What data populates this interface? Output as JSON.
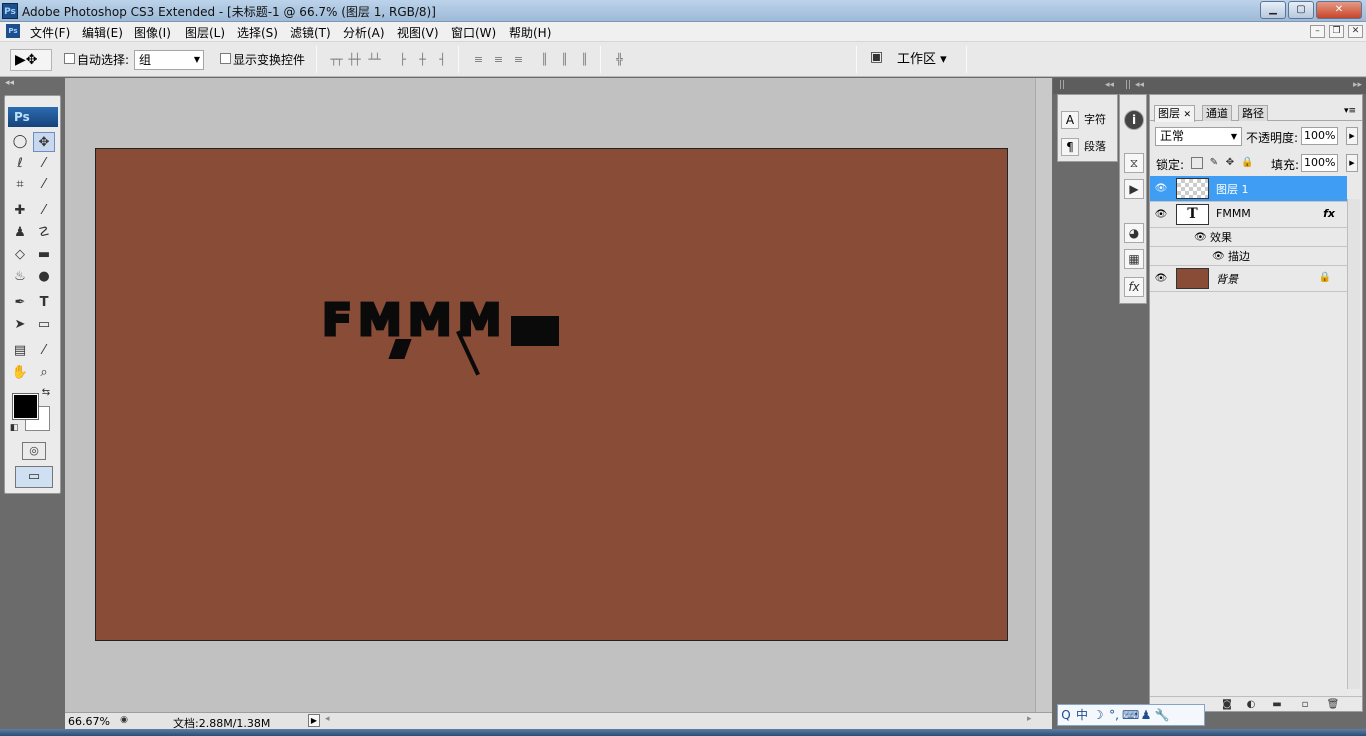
{
  "window": {
    "title": "Adobe Photoshop CS3 Extended - [未标题-1 @ 66.7% (图层 1, RGB/8)]",
    "ps_logo": "Ps",
    "min": "▁",
    "max": "▢",
    "close": "✕"
  },
  "menu": {
    "items": [
      "文件(F)",
      "编辑(E)",
      "图像(I)",
      "图层(L)",
      "选择(S)",
      "滤镜(T)",
      "分析(A)",
      "视图(V)",
      "窗口(W)",
      "帮助(H)"
    ],
    "mdi_min": "–",
    "mdi_restore": "❐",
    "mdi_close": "✕"
  },
  "options": {
    "tool_preset": "▶✥",
    "auto_select_label": "自动选择:",
    "auto_select_value": "组",
    "show_transform_label": "显示变换控件",
    "workspace_label": "工作区 ▾"
  },
  "toolbox": {
    "badge": "Ps"
  },
  "document": {
    "text": "FMMM"
  },
  "status": {
    "zoom": "66.67%",
    "doc_size": "文档:2.88M/1.38M"
  },
  "mini_panel": {
    "char_label": "字符",
    "para_label": "段落",
    "char_icon": "A",
    "para_icon": "¶"
  },
  "layers_panel": {
    "tabs": [
      "图层",
      "通道",
      "路径"
    ],
    "blend_mode": "正常",
    "opacity_label": "不透明度:",
    "opacity_value": "100%",
    "lock_label": "锁定:",
    "fill_label": "填充:",
    "fill_value": "100%",
    "layers": [
      {
        "name": "图层 1",
        "selected": true
      },
      {
        "name": "FMMM",
        "thumb_text": "T",
        "fx": "fx"
      },
      {
        "name": "背景",
        "locked": true
      }
    ],
    "effects_label": "效果",
    "stroke_label": "描边"
  },
  "ime": {
    "items": [
      "Q",
      "中",
      "☽",
      "°,",
      "⌨",
      "♟",
      "🔧"
    ]
  },
  "colors": {
    "canvas_fill": "#884c37",
    "selected_layer": "#3f9ef4",
    "workspace_bg": "#c1c1c1"
  }
}
